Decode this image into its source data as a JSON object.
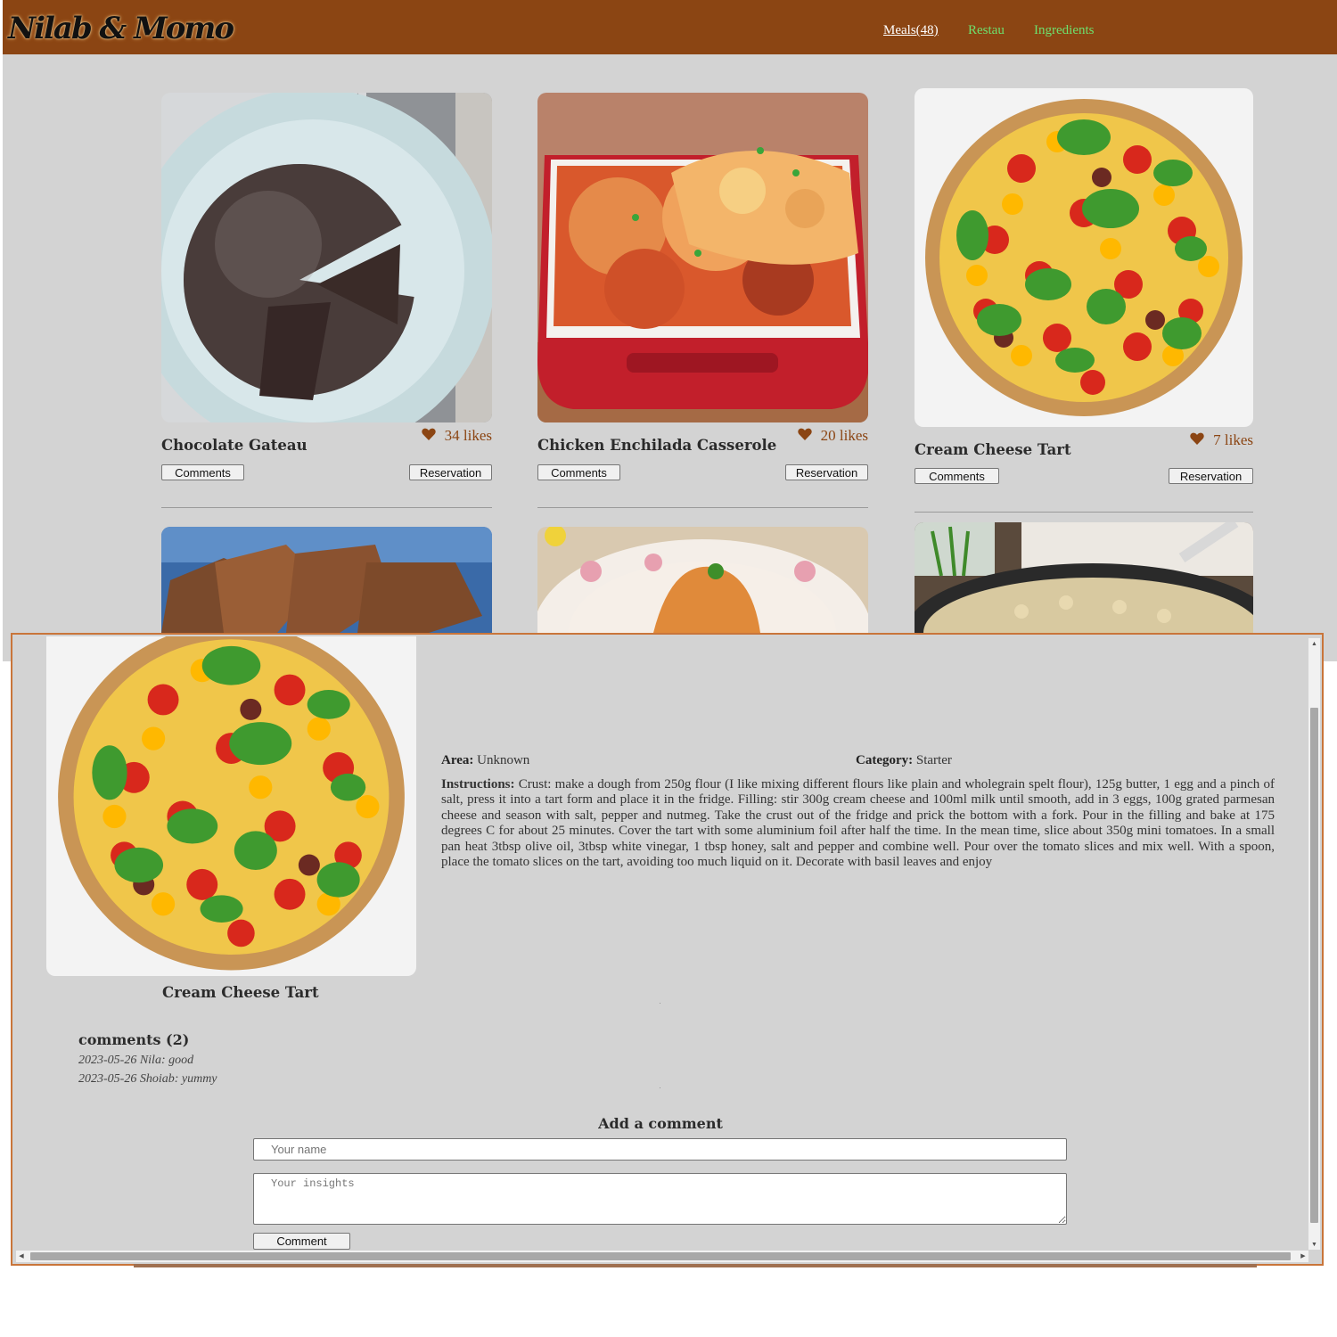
{
  "app": {
    "logo_text": "Nilab & Momo"
  },
  "nav": {
    "meals": "Meals(48)",
    "restau": "Restau",
    "ingredients": "Ingredients"
  },
  "cards": [
    {
      "title": "Chocolate Gateau",
      "likes": "34 likes",
      "comments_label": "Comments",
      "reservation_label": "Reservation"
    },
    {
      "title": "Chicken Enchilada Casserole",
      "likes": "20 likes",
      "comments_label": "Comments",
      "reservation_label": "Reservation"
    },
    {
      "title": "Cream Cheese Tart",
      "likes": "7 likes",
      "comments_label": "Comments",
      "reservation_label": "Reservation"
    }
  ],
  "popup": {
    "title": "Cream Cheese Tart",
    "area_label": "Area:",
    "area_value": "Unknown",
    "category_label": "Category:",
    "category_value": "Starter",
    "instructions_label": "Instructions:",
    "instructions": "Crust: make a dough from 250g flour (I like mixing different flours like plain and wholegrain spelt flour), 125g butter, 1 egg and a pinch of salt, press it into a tart form and place it in the fridge. Filling: stir 300g cream cheese and 100ml milk until smooth, add in 3 eggs, 100g grated parmesan cheese and season with salt, pepper and nutmeg. Take the crust out of the fridge and prick the bottom with a fork. Pour in the filling and bake at 175 degrees C for about 25 minutes. Cover the tart with some aluminium foil after half the time. In the mean time, slice about 350g mini tomatoes. In a small pan heat 3tbsp olive oil, 3tbsp white vinegar, 1 tbsp honey, salt and pepper and combine well. Pour over the tomato slices and mix well. With a spoon, place the tomato slices on the tart, avoiding too much liquid on it. Decorate with basil leaves and enjoy",
    "comments_heading": "comments (2)",
    "comments": [
      "2023-05-26 Nila: good",
      "2023-05-26 Shoiab: yummy"
    ],
    "add_comment_heading": "Add a comment",
    "name_placeholder": "Your name",
    "insights_placeholder": "Your insights",
    "submit_label": "Comment"
  },
  "colors": {
    "brand": "#8b4513",
    "page_bg": "#d3d3d3",
    "nav_link": "#6ee06e",
    "popup_border": "#c9753a"
  },
  "icons": [
    "heart-icon",
    "scroll-arrow-up-icon",
    "scroll-arrow-down-icon",
    "scroll-arrow-left-icon",
    "scroll-arrow-right-icon"
  ]
}
